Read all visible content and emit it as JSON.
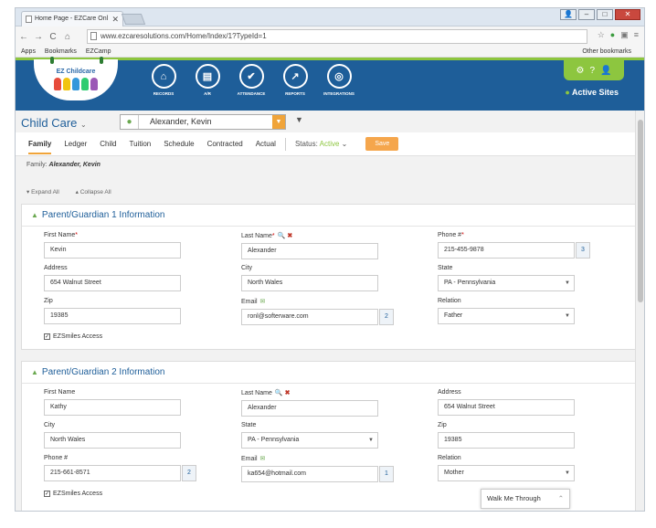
{
  "browser": {
    "tab_title": "Home Page - EZCare Onl",
    "url": "www.ezcaresolutions.com/Home/Index/1?TypeId=1",
    "bookmarks": [
      "Apps",
      "Bookmarks",
      "EZCamp"
    ],
    "other_bookmarks": "Other bookmarks"
  },
  "header": {
    "logo_text": "EZ Childcare",
    "nav": [
      {
        "label": "RECORDS",
        "icon": "house-icon"
      },
      {
        "label": "A/R",
        "icon": "ledger-icon"
      },
      {
        "label": "ATTENDANCE",
        "icon": "clipboard-check-icon"
      },
      {
        "label": "REPORTS",
        "icon": "chart-icon"
      },
      {
        "label": "INTEGRATIONS",
        "icon": "integrations-icon"
      }
    ],
    "active_sites": "Active Sites"
  },
  "toolbar": {
    "module": "Child Care",
    "person": "Alexander, Kevin"
  },
  "tabs": [
    "Family",
    "Ledger",
    "Child",
    "Tuition",
    "Schedule",
    "Contracted",
    "Actual"
  ],
  "status_label": "Status:",
  "status_value": "Active",
  "save_label": "Save",
  "family_label": "Family:",
  "family_name": "Alexander, Kevin",
  "expand_all": "Expand All",
  "collapse_all": "Collapse All",
  "guardian1": {
    "title": "Parent/Guardian 1 Information",
    "first_name_label": "First Name",
    "first_name": "Kevin",
    "last_name_label": "Last Name",
    "last_name": "Alexander",
    "phone_label": "Phone #",
    "phone": "215-455-9878",
    "phone_count": "3",
    "address_label": "Address",
    "address": "654 Walnut Street",
    "city_label": "City",
    "city": "North Wales",
    "state_label": "State",
    "state": "PA - Pennsylvania",
    "zip_label": "Zip",
    "zip": "19385",
    "email_label": "Email",
    "email": "ronl@softerware.com",
    "email_count": "2",
    "relation_label": "Relation",
    "relation": "Father",
    "ezsmiles": "EZSmiles Access"
  },
  "guardian2": {
    "title": "Parent/Guardian 2 Information",
    "first_name_label": "First Name",
    "first_name": "Kathy",
    "last_name_label": "Last Name",
    "last_name": "Alexander",
    "address_label": "Address",
    "address": "654 Walnut Street",
    "city_label": "City",
    "city": "North Wales",
    "state_label": "State",
    "state": "PA - Pennsylvania",
    "zip_label": "Zip",
    "zip": "19385",
    "phone_label": "Phone #",
    "phone": "215-661-8571",
    "phone_count": "2",
    "email_label": "Email",
    "email": "ka654@hotmail.com",
    "email_count": "1",
    "relation_label": "Relation",
    "relation": "Mother",
    "ezsmiles": "EZSmiles Access"
  },
  "walkme": "Walk Me Through"
}
